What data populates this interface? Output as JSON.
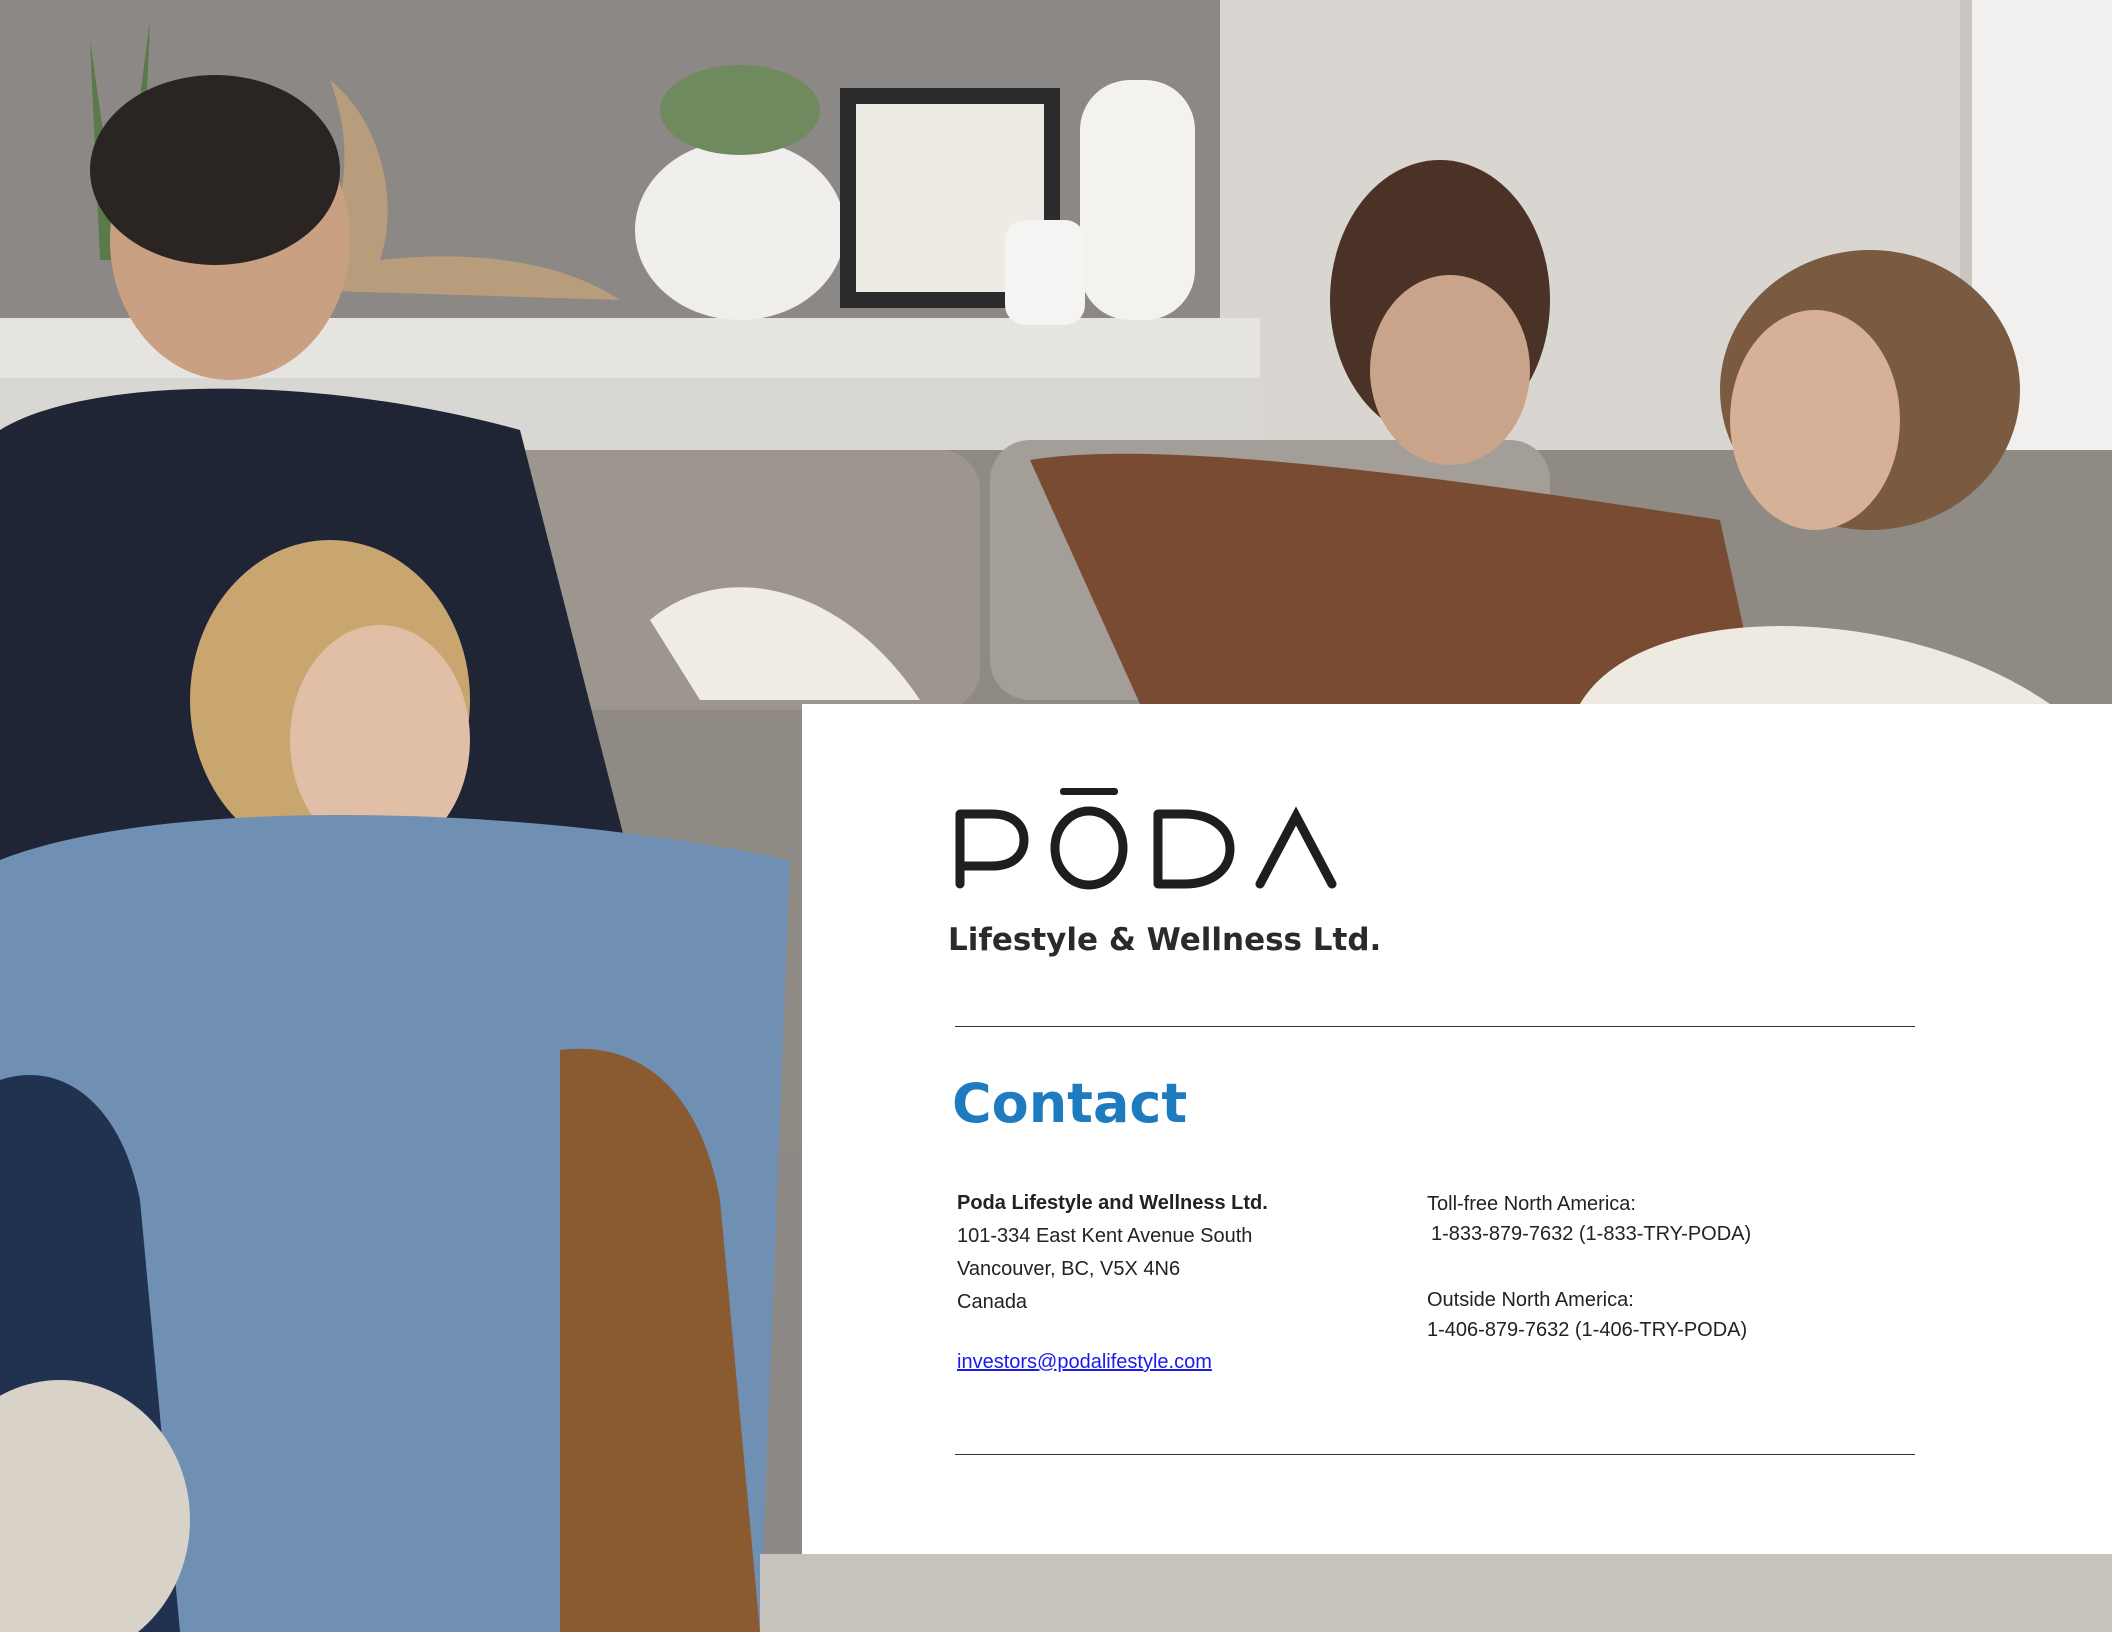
{
  "logo": {
    "wordmark": "PŌDA",
    "subtitle": "Lifestyle & Wellness Ltd."
  },
  "contact": {
    "heading": "Contact",
    "address": {
      "company": "Poda Lifestyle and Wellness Ltd.",
      "street": "101-334 East Kent Avenue South",
      "city": "Vancouver, BC, V5X 4N6",
      "country": "Canada"
    },
    "email": "investors@podalifestyle.com",
    "phones": {
      "tollfree_label": "Toll-free North America:",
      "tollfree_number": "1-833-879-7632 (1-833-TRY-PODA)",
      "outside_label": "Outside North America:",
      "outside_number": "1-406-879-7632 (1-406-TRY-PODA)"
    }
  },
  "colors": {
    "heading": "#1e7bbf",
    "link": "#1a1aee",
    "card": "#ffffff"
  }
}
